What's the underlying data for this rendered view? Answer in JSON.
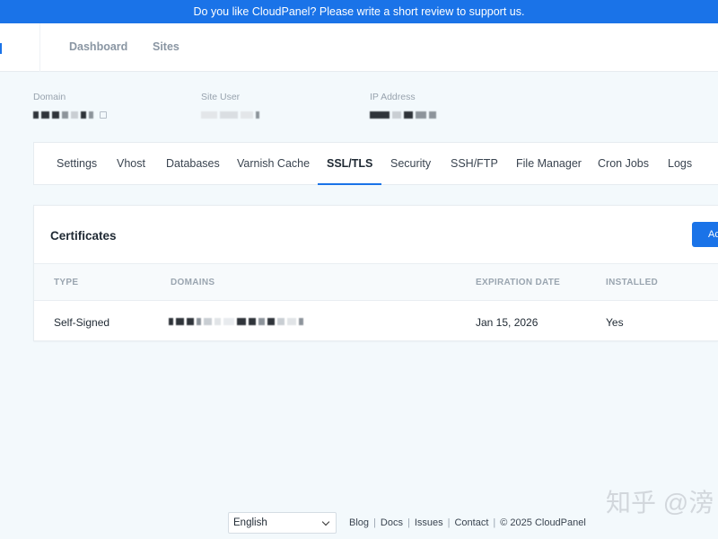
{
  "banner": {
    "text": "Do you like CloudPanel? Please write a short review to support us."
  },
  "topnav": {
    "items": [
      {
        "label": "Dashboard"
      },
      {
        "label": "Sites"
      }
    ]
  },
  "site_info": {
    "domain_label": "Domain",
    "site_user_label": "Site User",
    "ip_address_label": "IP Address"
  },
  "tabs": [
    {
      "label": "Settings"
    },
    {
      "label": "Vhost"
    },
    {
      "label": "Databases"
    },
    {
      "label": "Varnish Cache"
    },
    {
      "label": "SSL/TLS",
      "active": true
    },
    {
      "label": "Security"
    },
    {
      "label": "SSH/FTP"
    },
    {
      "label": "File Manager"
    },
    {
      "label": "Cron Jobs"
    },
    {
      "label": "Logs"
    }
  ],
  "certificates": {
    "title": "Certificates",
    "action_button": "Ac",
    "columns": [
      "TYPE",
      "DOMAINS",
      "EXPIRATION DATE",
      "INSTALLED"
    ],
    "rows": [
      {
        "type": "Self-Signed",
        "expiration_date": "Jan 15, 2026",
        "installed": "Yes"
      }
    ]
  },
  "footer": {
    "language": "English",
    "links": [
      "Blog",
      "Docs",
      "Issues",
      "Contact"
    ],
    "copyright": "© 2025  CloudPanel"
  },
  "watermark": {
    "text": "知乎 @滂"
  },
  "colors": {
    "accent": "#1a73e8",
    "background": "#f3f9fc"
  },
  "icons": {
    "external_link": "external-link-icon",
    "select_chevron": "chevron-down-icon"
  }
}
